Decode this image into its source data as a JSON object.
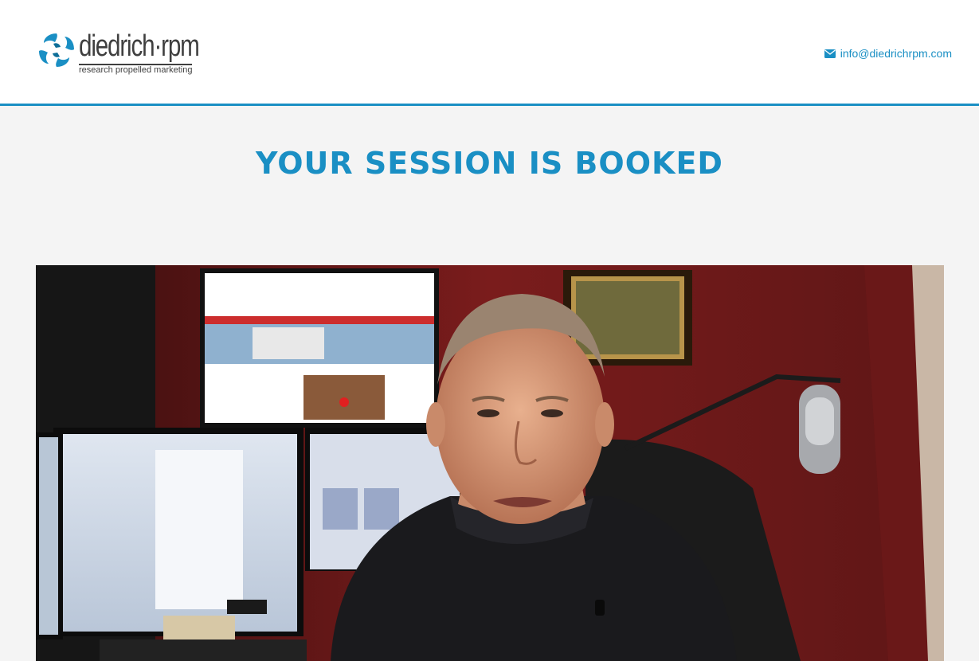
{
  "header": {
    "logo": {
      "wordmark": "diedrich·rpm",
      "tagline": "research propelled marketing",
      "brand_color": "#1a8fc4",
      "text_color": "#3f3f3f"
    },
    "contact": {
      "icon": "envelope-icon",
      "email": "info@diedrichrpm.com"
    }
  },
  "main": {
    "title": "YOUR SESSION IS BOOKED",
    "video": {
      "description_icon": "video-player",
      "thumbnail": "man-at-desk-with-monitors"
    }
  },
  "colors": {
    "accent": "#1a8fc4",
    "background": "#f4f4f4",
    "header_background": "#ffffff"
  }
}
